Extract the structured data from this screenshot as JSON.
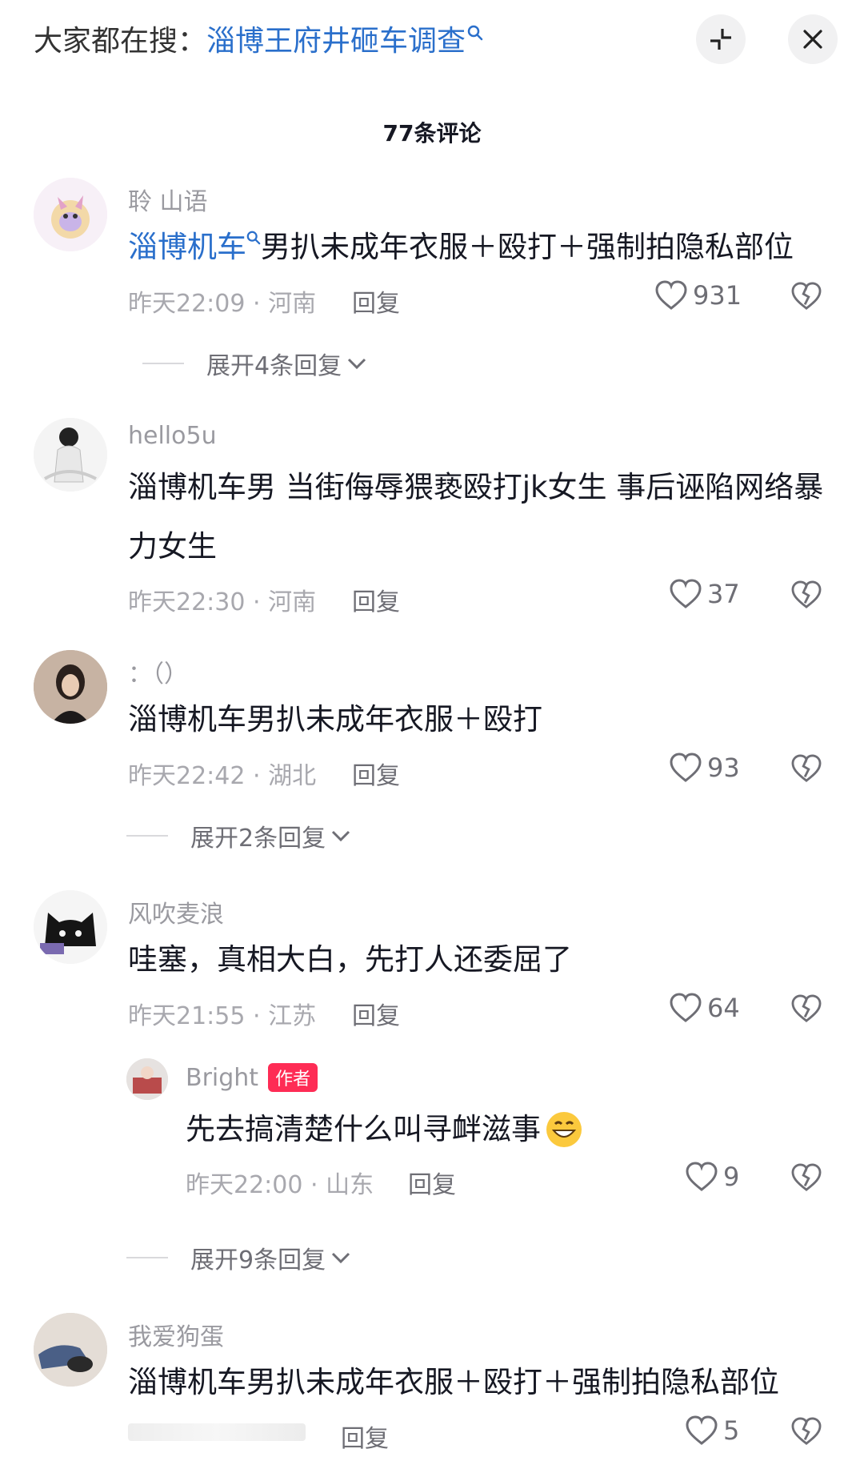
{
  "header": {
    "search_prefix": "大家都在搜：",
    "search_term": "淄博王府井砸车调查"
  },
  "comment_count": "77条评论",
  "comments": [
    {
      "username": "聆 山语",
      "link": "淄博机车",
      "text": "男扒未成年衣服＋殴打＋强制拍隐私部位",
      "time_location": "昨天22:09 · 河南",
      "reply_label": "回复",
      "likes": "931",
      "expand": "展开4条回复"
    },
    {
      "username": "hello5u",
      "text_line1": "淄博机车男 当街侮辱猥亵殴打jk女生 事后诬陷网络暴",
      "text_line2": "力女生",
      "time_location": "昨天22:30 · 河南",
      "reply_label": "回复",
      "likes": "37"
    },
    {
      "username": "：（）",
      "text": "淄博机车男扒未成年衣服＋殴打",
      "time_location": "昨天22:42 · 湖北",
      "reply_label": "回复",
      "likes": "93",
      "expand": "展开2条回复"
    },
    {
      "username": "风吹麦浪",
      "text": "哇塞，真相大白，先打人还委屈了",
      "time_location": "昨天21:55 · 江苏",
      "reply_label": "回复",
      "likes": "64",
      "sub_reply": {
        "username": "Bright",
        "badge": "作者",
        "text": "先去搞清楚什么叫寻衅滋事",
        "time_location": "昨天22:00 · 山东",
        "reply_label": "回复",
        "likes": "9"
      },
      "expand": "展开9条回复"
    },
    {
      "username": "我爱狗蛋",
      "text": "淄博机车男扒未成年衣服＋殴打＋强制拍隐私部位",
      "reply_label": "回复",
      "likes": "5"
    }
  ],
  "colors": {
    "link": "#2a6fcb",
    "badge": "#fe2c55"
  }
}
